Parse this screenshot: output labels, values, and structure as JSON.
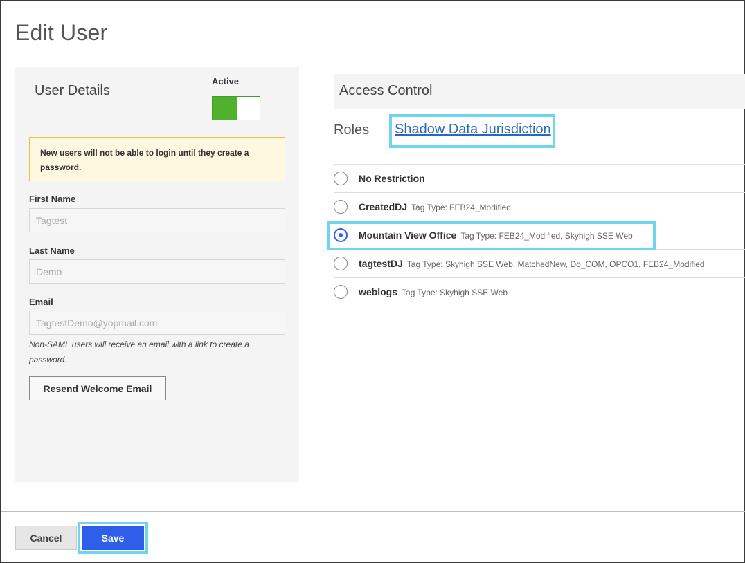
{
  "page": {
    "title": "Edit User"
  },
  "user_details": {
    "heading": "User Details",
    "active_label": "Active",
    "active": true,
    "notice": "New users will not be able to login until they create a password.",
    "first_name": {
      "label": "First Name",
      "placeholder": "Tagtest"
    },
    "last_name": {
      "label": "Last Name",
      "placeholder": "Demo"
    },
    "email": {
      "label": "Email",
      "placeholder": "TagtestDemo@yopmail.com"
    },
    "email_hint": "Non-SAML users will receive an email with a link to create a password.",
    "resend_label": "Resend Welcome Email"
  },
  "access_control": {
    "heading": "Access Control",
    "tabs": [
      {
        "label": "Roles",
        "active": false
      },
      {
        "label": "Shadow Data Jurisdiction",
        "active": true
      }
    ],
    "options": [
      {
        "name": "No Restriction",
        "tag": "",
        "selected": false
      },
      {
        "name": "CreatedDJ",
        "tag": "Tag Type: FEB24_Modified",
        "selected": false
      },
      {
        "name": "Mountain View Office",
        "tag": "Tag Type: FEB24_Modified, Skyhigh SSE Web",
        "selected": true
      },
      {
        "name": "tagtestDJ",
        "tag": "Tag Type: Skyhigh SSE Web, MatchedNew, Do_COM, OPCO1, FEB24_Modified",
        "selected": false
      },
      {
        "name": "weblogs",
        "tag": "Tag Type: Skyhigh SSE Web",
        "selected": false
      }
    ]
  },
  "footer": {
    "cancel_label": "Cancel",
    "save_label": "Save"
  },
  "colors": {
    "accent": "#2f5fe8",
    "toggle_on": "#50b12e",
    "highlight": "#6fd4ef",
    "notice_bg": "#fff8e0",
    "notice_border": "#f0c040"
  }
}
